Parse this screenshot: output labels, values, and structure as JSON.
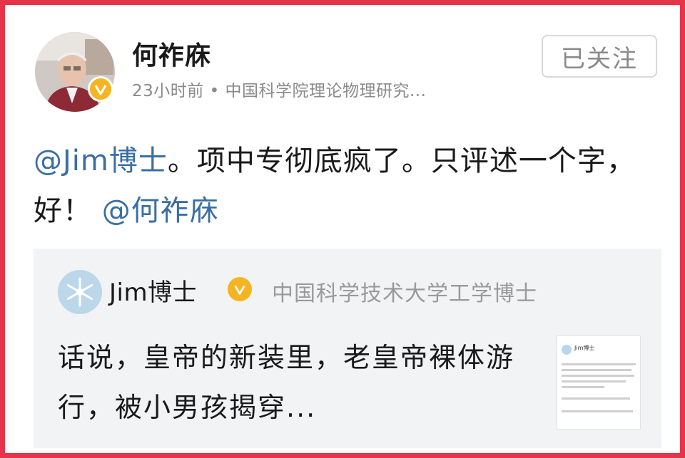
{
  "post": {
    "author_name": "何祚庥",
    "meta": "23小时前 • 中国科学院理论物理研究...",
    "follow_label": "已关注",
    "body": {
      "mention_1": "@Jim博士",
      "text_1": "。项中专彻底疯了。只评述一个字，好！",
      "mention_2": "@何祚庥"
    }
  },
  "quote": {
    "author_name": "Jim博士",
    "description": "中国科学技术大学工学博士",
    "text": "话说，皇帝的新装里，老皇帝裸体游行，被小男孩揭穿...",
    "thumbnail": {
      "name": "Jim博士"
    }
  },
  "colors": {
    "border": "#e6354a",
    "mention": "#3a6ea5",
    "verified_badge": "#f5b523",
    "quote_bg": "#f2f3f5"
  },
  "icons": {
    "verified": "verified-badge-icon",
    "author_avatar": "author-avatar",
    "quote_avatar": "snowflake-avatar"
  }
}
